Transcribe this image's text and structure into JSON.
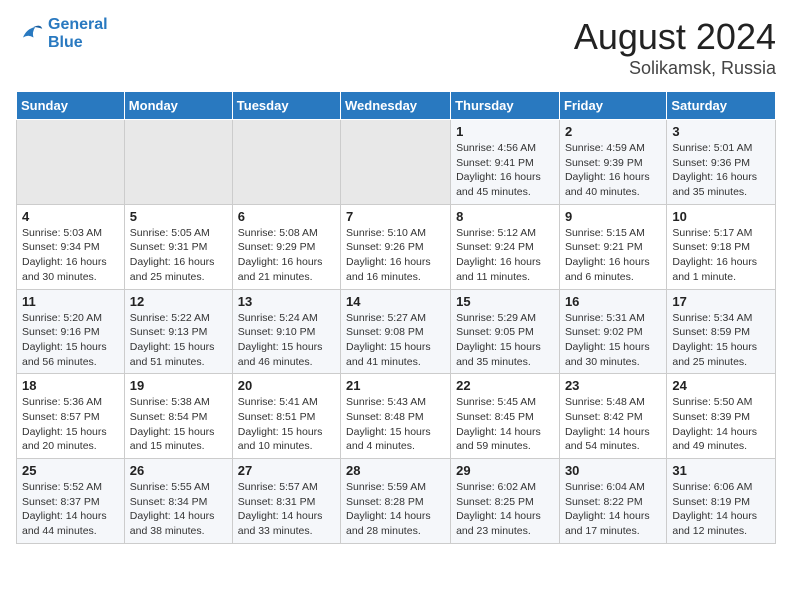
{
  "header": {
    "logo_line1": "General",
    "logo_line2": "Blue",
    "title": "August 2024",
    "subtitle": "Solikamsk, Russia"
  },
  "weekdays": [
    "Sunday",
    "Monday",
    "Tuesday",
    "Wednesday",
    "Thursday",
    "Friday",
    "Saturday"
  ],
  "weeks": [
    [
      {
        "day": "",
        "info": ""
      },
      {
        "day": "",
        "info": ""
      },
      {
        "day": "",
        "info": ""
      },
      {
        "day": "",
        "info": ""
      },
      {
        "day": "1",
        "info": "Sunrise: 4:56 AM\nSunset: 9:41 PM\nDaylight: 16 hours and 45 minutes."
      },
      {
        "day": "2",
        "info": "Sunrise: 4:59 AM\nSunset: 9:39 PM\nDaylight: 16 hours and 40 minutes."
      },
      {
        "day": "3",
        "info": "Sunrise: 5:01 AM\nSunset: 9:36 PM\nDaylight: 16 hours and 35 minutes."
      }
    ],
    [
      {
        "day": "4",
        "info": "Sunrise: 5:03 AM\nSunset: 9:34 PM\nDaylight: 16 hours and 30 minutes."
      },
      {
        "day": "5",
        "info": "Sunrise: 5:05 AM\nSunset: 9:31 PM\nDaylight: 16 hours and 25 minutes."
      },
      {
        "day": "6",
        "info": "Sunrise: 5:08 AM\nSunset: 9:29 PM\nDaylight: 16 hours and 21 minutes."
      },
      {
        "day": "7",
        "info": "Sunrise: 5:10 AM\nSunset: 9:26 PM\nDaylight: 16 hours and 16 minutes."
      },
      {
        "day": "8",
        "info": "Sunrise: 5:12 AM\nSunset: 9:24 PM\nDaylight: 16 hours and 11 minutes."
      },
      {
        "day": "9",
        "info": "Sunrise: 5:15 AM\nSunset: 9:21 PM\nDaylight: 16 hours and 6 minutes."
      },
      {
        "day": "10",
        "info": "Sunrise: 5:17 AM\nSunset: 9:18 PM\nDaylight: 16 hours and 1 minute."
      }
    ],
    [
      {
        "day": "11",
        "info": "Sunrise: 5:20 AM\nSunset: 9:16 PM\nDaylight: 15 hours and 56 minutes."
      },
      {
        "day": "12",
        "info": "Sunrise: 5:22 AM\nSunset: 9:13 PM\nDaylight: 15 hours and 51 minutes."
      },
      {
        "day": "13",
        "info": "Sunrise: 5:24 AM\nSunset: 9:10 PM\nDaylight: 15 hours and 46 minutes."
      },
      {
        "day": "14",
        "info": "Sunrise: 5:27 AM\nSunset: 9:08 PM\nDaylight: 15 hours and 41 minutes."
      },
      {
        "day": "15",
        "info": "Sunrise: 5:29 AM\nSunset: 9:05 PM\nDaylight: 15 hours and 35 minutes."
      },
      {
        "day": "16",
        "info": "Sunrise: 5:31 AM\nSunset: 9:02 PM\nDaylight: 15 hours and 30 minutes."
      },
      {
        "day": "17",
        "info": "Sunrise: 5:34 AM\nSunset: 8:59 PM\nDaylight: 15 hours and 25 minutes."
      }
    ],
    [
      {
        "day": "18",
        "info": "Sunrise: 5:36 AM\nSunset: 8:57 PM\nDaylight: 15 hours and 20 minutes."
      },
      {
        "day": "19",
        "info": "Sunrise: 5:38 AM\nSunset: 8:54 PM\nDaylight: 15 hours and 15 minutes."
      },
      {
        "day": "20",
        "info": "Sunrise: 5:41 AM\nSunset: 8:51 PM\nDaylight: 15 hours and 10 minutes."
      },
      {
        "day": "21",
        "info": "Sunrise: 5:43 AM\nSunset: 8:48 PM\nDaylight: 15 hours and 4 minutes."
      },
      {
        "day": "22",
        "info": "Sunrise: 5:45 AM\nSunset: 8:45 PM\nDaylight: 14 hours and 59 minutes."
      },
      {
        "day": "23",
        "info": "Sunrise: 5:48 AM\nSunset: 8:42 PM\nDaylight: 14 hours and 54 minutes."
      },
      {
        "day": "24",
        "info": "Sunrise: 5:50 AM\nSunset: 8:39 PM\nDaylight: 14 hours and 49 minutes."
      }
    ],
    [
      {
        "day": "25",
        "info": "Sunrise: 5:52 AM\nSunset: 8:37 PM\nDaylight: 14 hours and 44 minutes."
      },
      {
        "day": "26",
        "info": "Sunrise: 5:55 AM\nSunset: 8:34 PM\nDaylight: 14 hours and 38 minutes."
      },
      {
        "day": "27",
        "info": "Sunrise: 5:57 AM\nSunset: 8:31 PM\nDaylight: 14 hours and 33 minutes."
      },
      {
        "day": "28",
        "info": "Sunrise: 5:59 AM\nSunset: 8:28 PM\nDaylight: 14 hours and 28 minutes."
      },
      {
        "day": "29",
        "info": "Sunrise: 6:02 AM\nSunset: 8:25 PM\nDaylight: 14 hours and 23 minutes."
      },
      {
        "day": "30",
        "info": "Sunrise: 6:04 AM\nSunset: 8:22 PM\nDaylight: 14 hours and 17 minutes."
      },
      {
        "day": "31",
        "info": "Sunrise: 6:06 AM\nSunset: 8:19 PM\nDaylight: 14 hours and 12 minutes."
      }
    ]
  ]
}
